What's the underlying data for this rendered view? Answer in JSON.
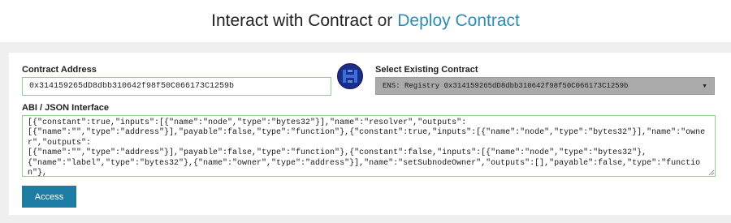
{
  "header": {
    "interact_label": "Interact with Contract",
    "separator": "or",
    "deploy_link": "Deploy Contract"
  },
  "form": {
    "contract_address_label": "Contract Address",
    "contract_address_value": "0x314159265dD8dbb310642f98f50C066173C1259b",
    "select_label": "Select Existing Contract",
    "select_value": "ENS: Registry 0x314159265dD8dbb310642f98f50C066173C1259b",
    "abi_label": "ABI / JSON Interface",
    "abi_value": "[{\"constant\":true,\"inputs\":[{\"name\":\"node\",\"type\":\"bytes32\"}],\"name\":\"resolver\",\"outputs\":\n[{\"name\":\"\",\"type\":\"address\"}],\"payable\":false,\"type\":\"function\"},{\"constant\":true,\"inputs\":[{\"name\":\"node\",\"type\":\"bytes32\"}],\"name\":\"owner\",\"outputs\":\n[{\"name\":\"\",\"type\":\"address\"}],\"payable\":false,\"type\":\"function\"},{\"constant\":false,\"inputs\":[{\"name\":\"node\",\"type\":\"bytes32\"},\n{\"name\":\"label\",\"type\":\"bytes32\"},{\"name\":\"owner\",\"type\":\"address\"}],\"name\":\"setSubnodeOwner\",\"outputs\":[],\"payable\":false,\"type\":\"function\"},\n{\"constant\":false,\"inputs\":[{\"name\":\"node\",\"type\":\"bytes32\"},{\"name\":\"ttl\",\"type\":\"uint64\"}],\"name\":\"setTTL\",\"outputs\":\n[],\"payable\":false,\"type\":\"function\"},{\"constant\":true,\"inputs\":[{\"name\":\"node\",\"type\":\"bytes32\"}],\"name\":\"ttl\",\"outputs\":",
    "access_button": "Access"
  },
  "icons": {
    "identicon": "contract-identicon",
    "select_caret": "caret-down-icon",
    "resize": "resize-grip-icon"
  },
  "colors": {
    "link": "#2c8db8",
    "button": "#1d7ca3",
    "valid_border": "#8fd08f",
    "select_bg": "#aaaaaa",
    "identicon_dark": "#1b2c8a",
    "identicon_light": "#3b6fd6"
  }
}
